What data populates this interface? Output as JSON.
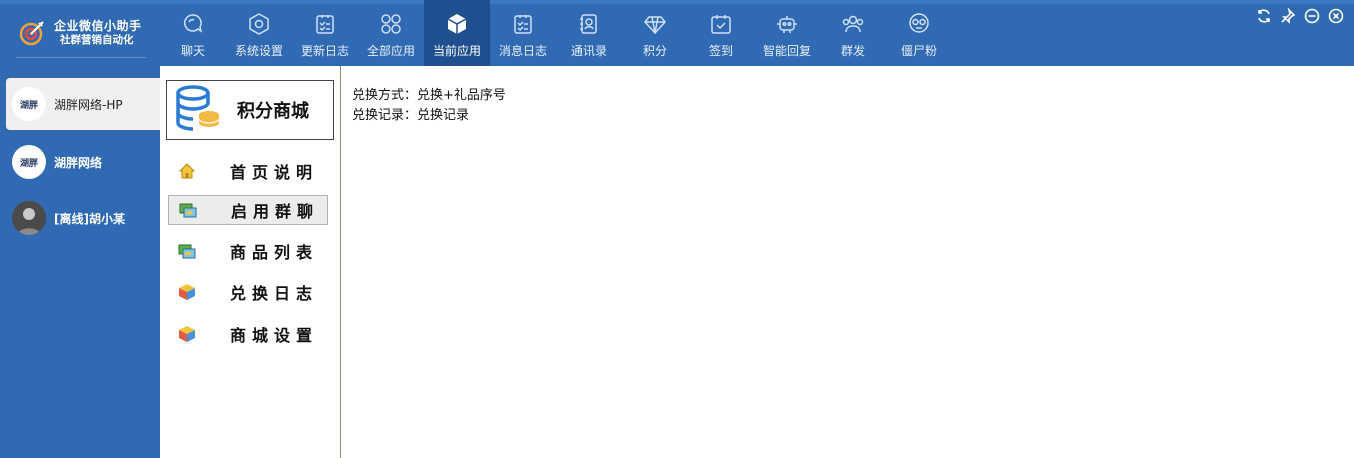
{
  "app": {
    "title": "企业微信小助手",
    "subtitle": "社群营销自动化"
  },
  "nav": [
    {
      "label": "聊天",
      "icon": "chat-icon"
    },
    {
      "label": "系统设置",
      "icon": "settings-hex-icon"
    },
    {
      "label": "更新日志",
      "icon": "update-log-icon"
    },
    {
      "label": "全部应用",
      "icon": "all-apps-icon"
    },
    {
      "label": "当前应用",
      "icon": "current-app-cube-icon"
    },
    {
      "label": "消息日志",
      "icon": "message-log-icon"
    },
    {
      "label": "通讯录",
      "icon": "contacts-icon"
    },
    {
      "label": "积分",
      "icon": "points-diamond-icon"
    },
    {
      "label": "签到",
      "icon": "checkin-icon"
    },
    {
      "label": "智能回复",
      "icon": "robot-icon"
    },
    {
      "label": "群发",
      "icon": "group-send-icon"
    },
    {
      "label": "僵尸粉",
      "icon": "zombie-fans-icon"
    }
  ],
  "active_nav": "当前应用",
  "contacts": [
    {
      "name": "湖胖网络-HP",
      "avatar_text": "湖胖",
      "active": true
    },
    {
      "name": "湖胖网络",
      "avatar_text": "湖胖",
      "active": false
    },
    {
      "name": "[离线]胡小某",
      "avatar_text": "",
      "active": false
    }
  ],
  "app_panel": {
    "title": "积分商城",
    "items": [
      {
        "label": "首页说明",
        "icon": "home-icon"
      },
      {
        "label": "启用群聊",
        "icon": "group-chat-icon"
      },
      {
        "label": "商品列表",
        "icon": "product-list-icon"
      },
      {
        "label": "兑换日志",
        "icon": "exchange-log-cube-icon"
      },
      {
        "label": "商城设置",
        "icon": "mall-settings-cube-icon"
      }
    ],
    "active_item": "启用群聊"
  },
  "content": {
    "line1": "兑换方式：兑换+礼品序号",
    "line2": "兑换记录：兑换记录"
  },
  "colors": {
    "topbar": "#2f6ab3",
    "active_nav": "#1f4f8e",
    "sidebar": "#2f6ab3"
  }
}
